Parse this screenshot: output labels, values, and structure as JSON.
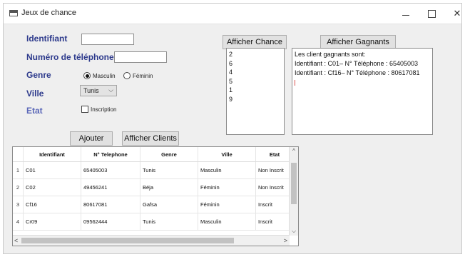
{
  "window": {
    "title": "Jeux de chance"
  },
  "form": {
    "identifiant_label": "Identifiant",
    "identifiant_value": "",
    "telephone_label": "Numéro de téléphone",
    "telephone_value": "",
    "genre_label": "Genre",
    "genre_options": [
      "Masculin",
      "Féminin"
    ],
    "genre_selected": "Masculin",
    "ville_label": "Ville",
    "ville_value": "Tunis",
    "etat_label": "Etat",
    "inscription_label": "Inscription",
    "inscription_checked": false
  },
  "buttons": {
    "ajouter": "Ajouter",
    "afficher_clients": "Afficher Clients",
    "afficher_chance": "Afficher Chance",
    "afficher_gagnants": "Afficher Gagnants"
  },
  "chance_list": [
    "2",
    "6",
    "4",
    "5",
    "1",
    "9"
  ],
  "gagnants": {
    "header": "Les client gagnants sont:",
    "lines": [
      "Identifiant : C01– N° Téléphone : 65405003",
      "Identifiant : Cf16– N° Téléphone : 80617081"
    ]
  },
  "table": {
    "columns": [
      "Identifiant",
      "N° Telephone",
      "Genre",
      "Ville",
      "Etat"
    ],
    "rows": [
      {
        "num": "1",
        "cells": [
          "C01",
          "65405003",
          "Tunis",
          "Masculin",
          "Non Inscrit"
        ]
      },
      {
        "num": "2",
        "cells": [
          "C02",
          "49456241",
          "Béja",
          "Féminin",
          "Non Inscrit"
        ]
      },
      {
        "num": "3",
        "cells": [
          "Cf16",
          "80617081",
          "Gafsa",
          "Féminin",
          "Inscrit"
        ]
      },
      {
        "num": "4",
        "cells": [
          "Cr09",
          "09562444",
          "Tunis",
          "Masculin",
          "Inscrit"
        ]
      }
    ]
  },
  "icons": {
    "app": "app-window-icon",
    "minimize": "minimize-icon",
    "maximize": "maximize-icon",
    "close": "close-icon"
  }
}
